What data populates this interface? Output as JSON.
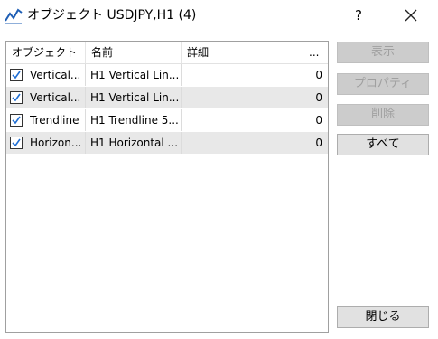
{
  "window": {
    "title": "オブジェクト USDJPY,H1 (4)",
    "help": "?",
    "icon": "chart-line-icon",
    "close_icon": "close-icon"
  },
  "table": {
    "columns": [
      "オブジェクト",
      "名前",
      "詳細",
      "..."
    ],
    "rows": [
      {
        "checked": true,
        "object": "Vertical...",
        "name": "H1 Vertical Lin...",
        "detail": "",
        "count": "0"
      },
      {
        "checked": true,
        "object": "Vertical...",
        "name": "H1 Vertical Lin...",
        "detail": "",
        "count": "0"
      },
      {
        "checked": true,
        "object": "Trendline",
        "name": "H1 Trendline 5...",
        "detail": "",
        "count": "0"
      },
      {
        "checked": true,
        "object": "Horizon...",
        "name": "H1 Horizontal ...",
        "detail": "",
        "count": "0"
      }
    ]
  },
  "buttons": {
    "show": "表示",
    "properties": "プロパティ",
    "delete": "削除",
    "all": "すべて",
    "close": "閉じる"
  },
  "colors": {
    "selected_row": "#e8e8e8",
    "button_face": "#e1e1e1",
    "disabled_text": "#a0a0a0",
    "check_mark": "#1f6ed4"
  }
}
